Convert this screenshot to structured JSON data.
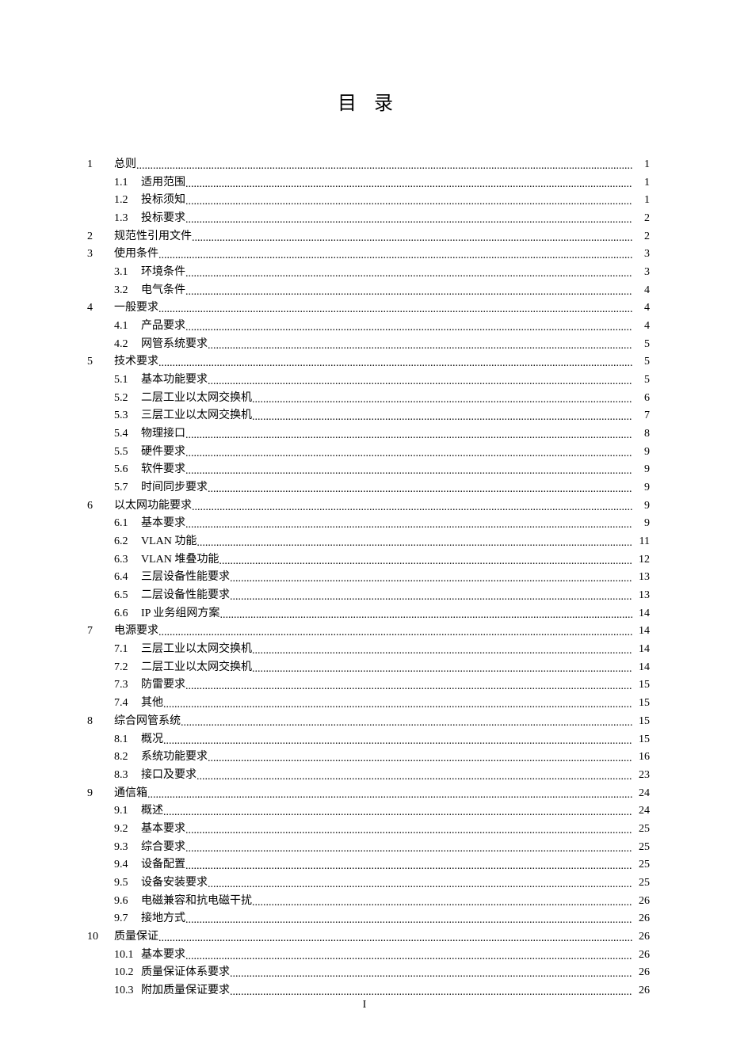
{
  "title": "目  录",
  "footer": "I",
  "entries": [
    {
      "level": 1,
      "num": "1",
      "label": "总则",
      "page": "1"
    },
    {
      "level": 2,
      "num": "1.1",
      "label": "适用范围",
      "page": "1"
    },
    {
      "level": 2,
      "num": "1.2",
      "label": "投标须知",
      "page": "1"
    },
    {
      "level": 2,
      "num": "1.3",
      "label": "投标要求",
      "page": "2"
    },
    {
      "level": 1,
      "num": "2",
      "label": "规范性引用文件",
      "page": "2"
    },
    {
      "level": 1,
      "num": "3",
      "label": "使用条件",
      "page": "3"
    },
    {
      "level": 2,
      "num": "3.1",
      "label": "环境条件",
      "page": "3"
    },
    {
      "level": 2,
      "num": "3.2",
      "label": "电气条件",
      "page": "4"
    },
    {
      "level": 1,
      "num": "4",
      "label": "一般要求",
      "page": "4"
    },
    {
      "level": 2,
      "num": "4.1",
      "label": "产品要求",
      "page": "4"
    },
    {
      "level": 2,
      "num": "4.2",
      "label": "网管系统要求",
      "page": "5"
    },
    {
      "level": 1,
      "num": "5",
      "label": "技术要求",
      "page": "5"
    },
    {
      "level": 2,
      "num": "5.1",
      "label": "基本功能要求",
      "page": "5"
    },
    {
      "level": 2,
      "num": "5.2",
      "label": "二层工业以太网交换机",
      "page": "6"
    },
    {
      "level": 2,
      "num": "5.3",
      "label": "三层工业以太网交换机",
      "page": "7"
    },
    {
      "level": 2,
      "num": "5.4",
      "label": "物理接口",
      "page": "8"
    },
    {
      "level": 2,
      "num": "5.5",
      "label": "硬件要求",
      "page": "9"
    },
    {
      "level": 2,
      "num": "5.6",
      "label": "软件要求",
      "page": "9"
    },
    {
      "level": 2,
      "num": "5.7",
      "label": "时间同步要求",
      "page": "9"
    },
    {
      "level": 1,
      "num": "6",
      "label": "以太网功能要求",
      "page": "9"
    },
    {
      "level": 2,
      "num": "6.1",
      "label": "基本要求",
      "page": "9"
    },
    {
      "level": 2,
      "num": "6.2",
      "label": "VLAN 功能",
      "page": "11"
    },
    {
      "level": 2,
      "num": "6.3",
      "label": "VLAN 堆叠功能",
      "page": "12"
    },
    {
      "level": 2,
      "num": "6.4",
      "label": "三层设备性能要求",
      "page": "13"
    },
    {
      "level": 2,
      "num": "6.5",
      "label": "二层设备性能要求",
      "page": "13"
    },
    {
      "level": 2,
      "num": "6.6",
      "label": "IP 业务组网方案",
      "page": "14"
    },
    {
      "level": 1,
      "num": "7",
      "label": "电源要求",
      "page": "14"
    },
    {
      "level": 2,
      "num": "7.1",
      "label": "三层工业以太网交换机",
      "page": "14"
    },
    {
      "level": 2,
      "num": "7.2",
      "label": "二层工业以太网交换机",
      "page": "14"
    },
    {
      "level": 2,
      "num": "7.3",
      "label": "防雷要求",
      "page": "15"
    },
    {
      "level": 2,
      "num": "7.4",
      "label": "其他",
      "page": "15"
    },
    {
      "level": 1,
      "num": "8",
      "label": "综合网管系统",
      "page": "15"
    },
    {
      "level": 2,
      "num": "8.1",
      "label": "概况",
      "page": "15"
    },
    {
      "level": 2,
      "num": "8.2",
      "label": "系统功能要求",
      "page": "16"
    },
    {
      "level": 2,
      "num": "8.3",
      "label": "接口及要求",
      "page": "23"
    },
    {
      "level": 1,
      "num": "9",
      "label": "通信箱",
      "page": "24"
    },
    {
      "level": 2,
      "num": "9.1",
      "label": "概述",
      "page": "24"
    },
    {
      "level": 2,
      "num": "9.2",
      "label": "基本要求",
      "page": "25"
    },
    {
      "level": 2,
      "num": "9.3",
      "label": "综合要求",
      "page": "25"
    },
    {
      "level": 2,
      "num": "9.4",
      "label": "设备配置",
      "page": "25"
    },
    {
      "level": 2,
      "num": "9.5",
      "label": "设备安装要求",
      "page": "25"
    },
    {
      "level": 2,
      "num": "9.6",
      "label": "电磁兼容和抗电磁干扰",
      "page": "26"
    },
    {
      "level": 2,
      "num": "9.7",
      "label": "接地方式",
      "page": "26"
    },
    {
      "level": 1,
      "num": "10",
      "label": "质量保证",
      "page": "26"
    },
    {
      "level": 2,
      "num": "10.1",
      "label": "基本要求",
      "page": "26"
    },
    {
      "level": 2,
      "num": "10.2",
      "label": "质量保证体系要求",
      "page": "26"
    },
    {
      "level": 2,
      "num": "10.3",
      "label": "附加质量保证要求",
      "page": "26"
    }
  ]
}
